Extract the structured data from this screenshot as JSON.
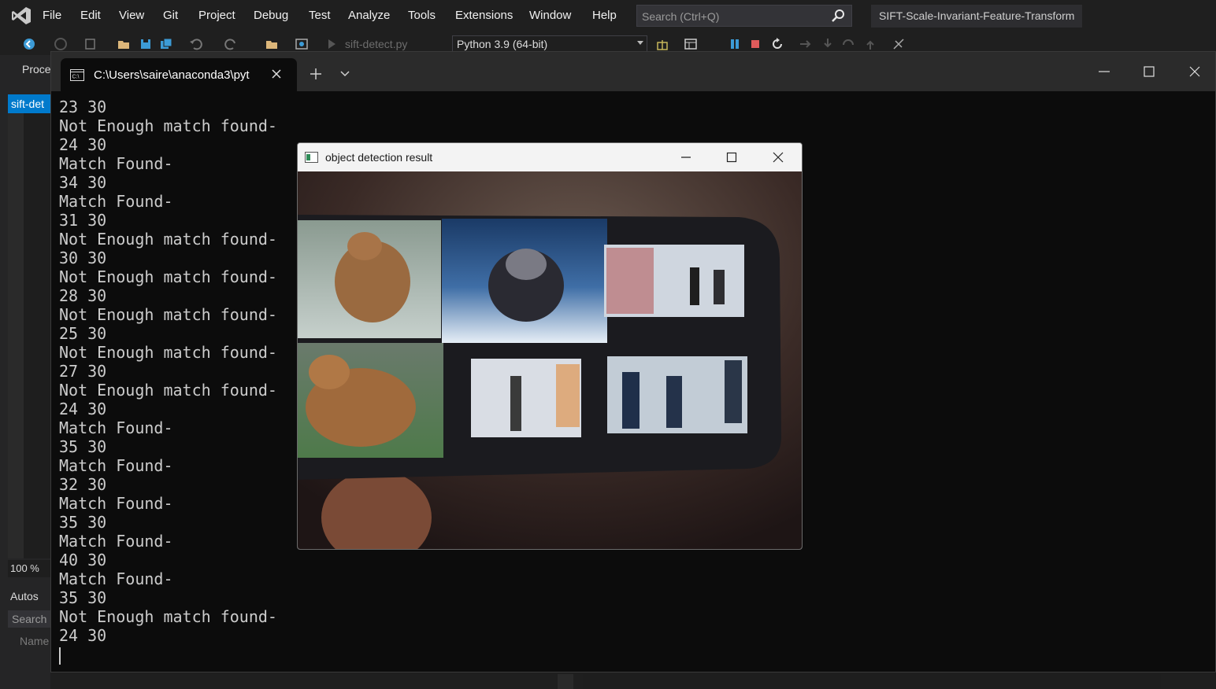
{
  "vs": {
    "menu": [
      "File",
      "Edit",
      "View",
      "Git",
      "Project",
      "Debug",
      "Test",
      "Analyze",
      "Tools",
      "Extensions",
      "Window",
      "Help"
    ],
    "search_placeholder": "Search (Ctrl+Q)",
    "solution_title": "SIFT-Scale-Invariant-Feature-Transform",
    "toolbar": {
      "startup_file": "sift-detect.py",
      "python_environment": "Python 3.9 (64-bit)"
    },
    "left_panel": {
      "process_label": "Proce",
      "editor_tab": "sift-det",
      "zoom": "100 %",
      "autos_tab": "Autos",
      "search_label": "Search",
      "name_column": "Name"
    }
  },
  "terminal": {
    "tab_title": "C:\\Users\\saire\\anaconda3\\pyt",
    "output": "23 30\nNot Enough match found-\n24 30\nMatch Found-\n34 30\nMatch Found-\n31 30\nNot Enough match found-\n30 30\nNot Enough match found-\n28 30\nNot Enough match found-\n25 30\nNot Enough match found-\n27 30\nNot Enough match found-\n24 30\nMatch Found-\n35 30\nMatch Found-\n32 30\nMatch Found-\n35 30\nMatch Found-\n40 30\nMatch Found-\n35 30\nNot Enough match found-\n24 30\n"
  },
  "cv_window": {
    "title": "object detection result"
  },
  "colors": {
    "vs_background": "#1f1f1f",
    "vs_accent": "#007acc",
    "terminal_background": "#0c0c0c",
    "terminal_text": "#cccccc",
    "pause_icon": "#3c9bd6",
    "stop_icon": "#e05b5b"
  }
}
